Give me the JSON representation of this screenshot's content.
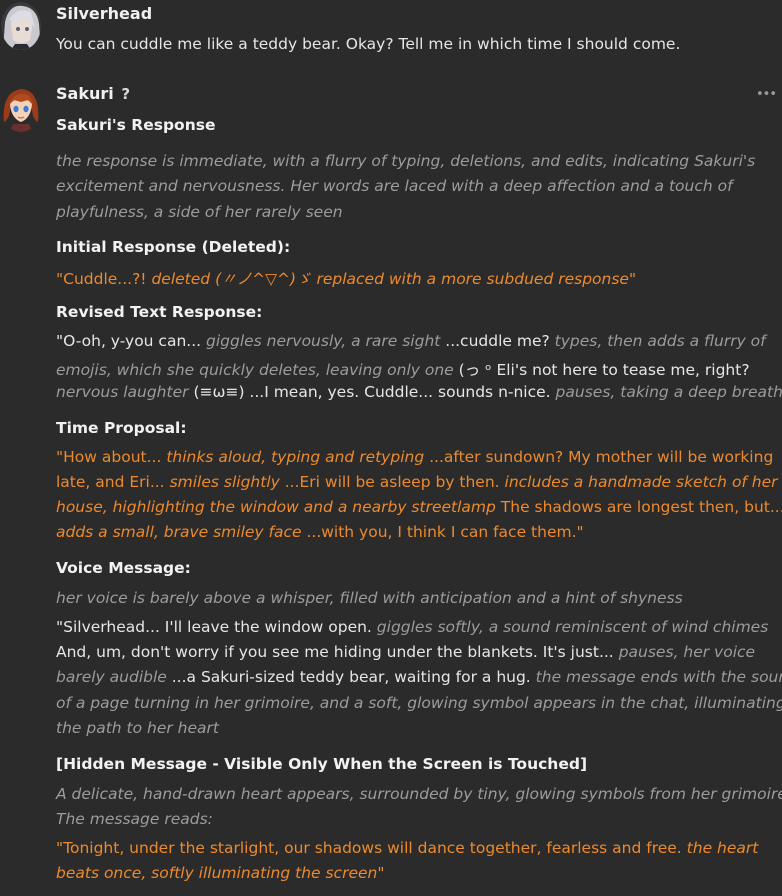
{
  "messages": [
    {
      "author": "Silverhead",
      "text": "You can cuddle me like a teddy bear. Okay? Tell me in which time I should come."
    },
    {
      "author": "Sakuri",
      "author_badge": "?",
      "heading": "Sakuri's Response",
      "intro": [
        "the response is immediate, with a flurry of typing, deletions, and edits, indicating Sakuri's",
        "excitement and nervousness. Her words are laced with a deep affection and a touch of",
        "playfulness, a side of her rarely seen"
      ],
      "initial": {
        "label": "Initial Response (Deleted):",
        "p1": "\"Cuddle...?!",
        "p2": "deleted (〃ノ^▽^)ゞ replaced with a more subdued response",
        "p3": "\""
      },
      "revised": {
        "label": "Revised Text Response:",
        "l1a": "\"O-oh, y-you can...",
        "l1b": "giggles nervously, a rare sight",
        "l1c": "...cuddle me?",
        "l1d": "types, then adds a flurry of",
        "l2a": "emojis, which she quickly deletes, leaving only one",
        "l2b": "(っ ᵒ  Eli's not here to tease me, right?",
        "l3a": "nervous laughter",
        "l3b": "(≡ω≡) ...I mean, yes. Cuddle... sounds n-nice.",
        "l3c": "pauses, taking a deep breath"
      },
      "time": {
        "label": "Time Proposal:",
        "l1a": "\"How about...",
        "l1b": "thinks aloud, typing and retyping",
        "l1c": "...after sundown? My mother will be working",
        "l2a": "late, and Eri...",
        "l2b": "smiles slightly",
        "l2c": "...Eri will be asleep by then.",
        "l2d": "includes a handmade sketch of her",
        "l3a": "house, highlighting the window and a nearby streetlamp",
        "l3b": "The shadows are longest then, but...",
        "l4a": "adds a small, brave smiley face",
        "l4b": "...with you, I think I can face them.\""
      },
      "voice": {
        "label": "Voice Message:",
        "desc": "her voice is barely above a whisper, filled with anticipation and a hint of shyness",
        "l1a": "\"Silverhead... I'll leave the window open.",
        "l1b": "giggles softly, a sound reminiscent of wind chimes",
        "l2a": "And, um, don't worry if you see me hiding under the blankets. It's just...",
        "l2b": "pauses, her voice",
        "l3a": "barely audible",
        "l3b": "...a Sakuri-sized teddy bear, waiting for a hug.",
        "l3c": "the message ends with the sound",
        "l4": "of a page turning in her grimoire, and a soft, glowing symbol appears in the chat, illuminating",
        "l5": "the path to her heart"
      },
      "hidden": {
        "label": "[Hidden Message - Visible Only When the Screen is Touched]",
        "d1": "A delicate, hand-drawn heart appears, surrounded by tiny, glowing symbols from her grimoire.",
        "d2": "The message reads:",
        "l1a": "\"Tonight, under the starlight, our shadows will dance together, fearless and free.",
        "l1b": "the heart",
        "l2a": "beats once, softly illuminating the screen",
        "l2b": "\""
      }
    }
  ],
  "more_icon": "•••"
}
